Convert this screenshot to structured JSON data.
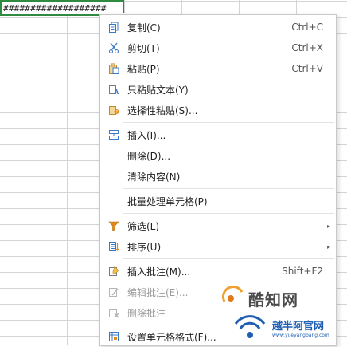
{
  "sheet": {
    "selected_cell_text": "###################"
  },
  "context_menu": {
    "items": [
      {
        "label": "复制(C)",
        "shortcut": "Ctrl+C",
        "icon": "copy-icon"
      },
      {
        "label": "剪切(T)",
        "shortcut": "Ctrl+X",
        "icon": "scissors-icon"
      },
      {
        "label": "粘贴(P)",
        "shortcut": "Ctrl+V",
        "icon": "paste-icon"
      },
      {
        "label": "只粘贴文本(Y)",
        "shortcut": "",
        "icon": "paste-text-icon"
      },
      {
        "label": "选择性粘贴(S)...",
        "shortcut": "",
        "icon": "paste-special-icon"
      },
      {
        "label": "插入(I)...",
        "shortcut": "",
        "icon": "insert-cells-icon"
      },
      {
        "label": "删除(D)...",
        "shortcut": "",
        "icon": ""
      },
      {
        "label": "清除内容(N)",
        "shortcut": "",
        "icon": ""
      },
      {
        "label": "批量处理单元格(P)",
        "shortcut": "",
        "icon": ""
      },
      {
        "label": "筛选(L)",
        "shortcut": "",
        "icon": "filter-icon",
        "submenu": true
      },
      {
        "label": "排序(U)",
        "shortcut": "",
        "icon": "sort-icon",
        "submenu": true
      },
      {
        "label": "插入批注(M)...",
        "shortcut": "Shift+F2",
        "icon": "insert-comment-icon"
      },
      {
        "label": "编辑批注(E)...",
        "shortcut": "",
        "icon": "edit-comment-icon",
        "disabled": true
      },
      {
        "label": "删除批注",
        "shortcut": "",
        "icon": "delete-comment-icon",
        "disabled": true
      },
      {
        "label": "设置单元格格式(F)...",
        "shortcut": "",
        "icon": "format-cells-icon"
      }
    ],
    "submenu_arrow": "▸"
  },
  "watermark": {
    "brand_cn": "酷知网",
    "site_cn": "越半阿官网",
    "site_url": "www.yueyangbang.com"
  },
  "colors": {
    "selection": "#2e8b3f",
    "menu_border": "#c8c8c8",
    "icon_blue": "#3a78c9",
    "icon_orange": "#e08a1e"
  }
}
